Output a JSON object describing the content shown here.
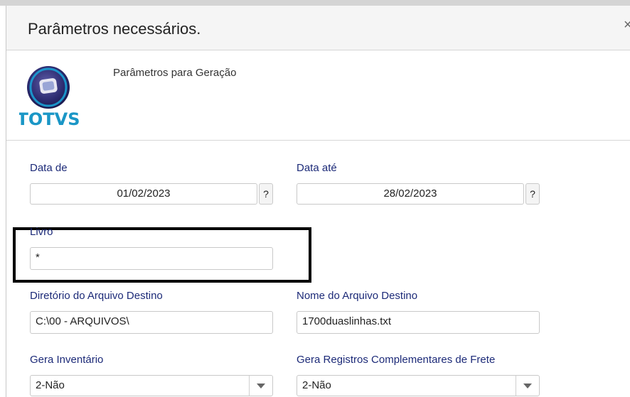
{
  "dialog": {
    "title": "Parâmetros necessários.",
    "close_glyph": "×",
    "subtitle": "Parâmetros para Geração",
    "logo_text": "TOTVS"
  },
  "form": {
    "data_de": {
      "label": "Data de",
      "value": "01/02/2023",
      "help": "?"
    },
    "data_ate": {
      "label": "Data até",
      "value": "28/02/2023",
      "help": "?"
    },
    "livro": {
      "label": "Livro",
      "value": "*"
    },
    "diretorio": {
      "label": "Diretório do Arquivo Destino",
      "value": "C:\\00 - ARQUIVOS\\"
    },
    "nome_arquivo": {
      "label": "Nome do Arquivo Destino",
      "value": "1700duaslinhas.txt"
    },
    "gera_inventario": {
      "label": "Gera Inventário",
      "value": "2-Não"
    },
    "gera_registros": {
      "label": "Gera Registros Complementares de Frete",
      "value": "2-Não"
    }
  },
  "icons": {
    "close": "close-icon",
    "dropdown": "chevron-down-icon",
    "logo": "totvs-logo"
  },
  "colors": {
    "label": "#1c2a78",
    "logo_text": "#1a96c6",
    "highlight_border": "#000000"
  }
}
